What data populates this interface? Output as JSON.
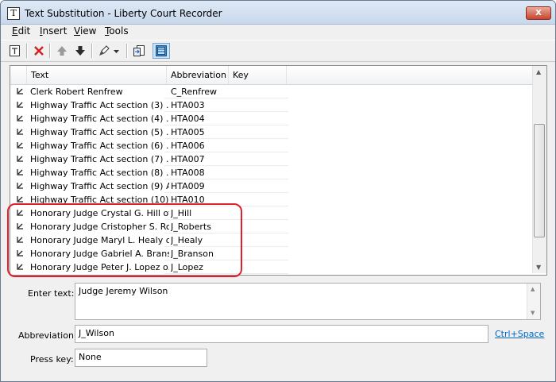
{
  "window": {
    "title": "Text Substitution - Liberty Court Recorder",
    "icon_glyph": "T",
    "close_glyph": "X"
  },
  "menu": [
    {
      "pre": "",
      "u": "E",
      "post": "dit"
    },
    {
      "pre": "",
      "u": "I",
      "post": "nsert"
    },
    {
      "pre": "",
      "u": "V",
      "post": "iew"
    },
    {
      "pre": "",
      "u": "T",
      "post": "ools"
    }
  ],
  "list": {
    "columns": [
      "Text",
      "Abbreviation",
      "Key"
    ],
    "rows": [
      {
        "text": "Clerk Robert Renfrew",
        "abbr": "C_Renfrew"
      },
      {
        "text": "Highway Traffic Act section (3)  ...",
        "abbr": "HTA003"
      },
      {
        "text": "Highway Traffic Act section (4)  ...",
        "abbr": "HTA004"
      },
      {
        "text": "Highway Traffic Act section (5)  ...",
        "abbr": "HTA005"
      },
      {
        "text": "Highway Traffic Act section (6)  ...",
        "abbr": "HTA006"
      },
      {
        "text": "Highway Traffic Act section (7)  ...",
        "abbr": "HTA007"
      },
      {
        "text": "Highway Traffic Act section (8)  ...",
        "abbr": "HTA008"
      },
      {
        "text": "Highway Traffic Act section (9) A...",
        "abbr": "HTA009"
      },
      {
        "text": "Highway Traffic Act section (10)...",
        "abbr": "HTA010"
      },
      {
        "text": "Honorary Judge Crystal G. Hill of ...",
        "abbr": "J_Hill"
      },
      {
        "text": "Honorary Judge Cristopher S. Ro...",
        "abbr": "J_Roberts"
      },
      {
        "text": "Honorary Judge Maryl L. Healy o...",
        "abbr": "J_Healy"
      },
      {
        "text": "Honorary Judge Gabriel A. Brans...",
        "abbr": "J_Branson"
      },
      {
        "text": "Honorary Judge Peter J. Lopez o...",
        "abbr": "J_Lopez"
      }
    ]
  },
  "form": {
    "enter_text_label": "Enter text:",
    "enter_text_value": "Judge Jeremy Wilson",
    "abbreviation_label": "Abbreviation:",
    "abbreviation_value": "J_Wilson",
    "shortcut_link": "Ctrl+Space",
    "press_key_label": "Press key:",
    "press_key_value": "None"
  },
  "toolbar_icons": [
    "text-template-icon",
    "delete-icon",
    "move-up-icon",
    "move-down-icon",
    "pen-icon",
    "dropdown-icon",
    "import-icon",
    "grid-view-icon"
  ]
}
